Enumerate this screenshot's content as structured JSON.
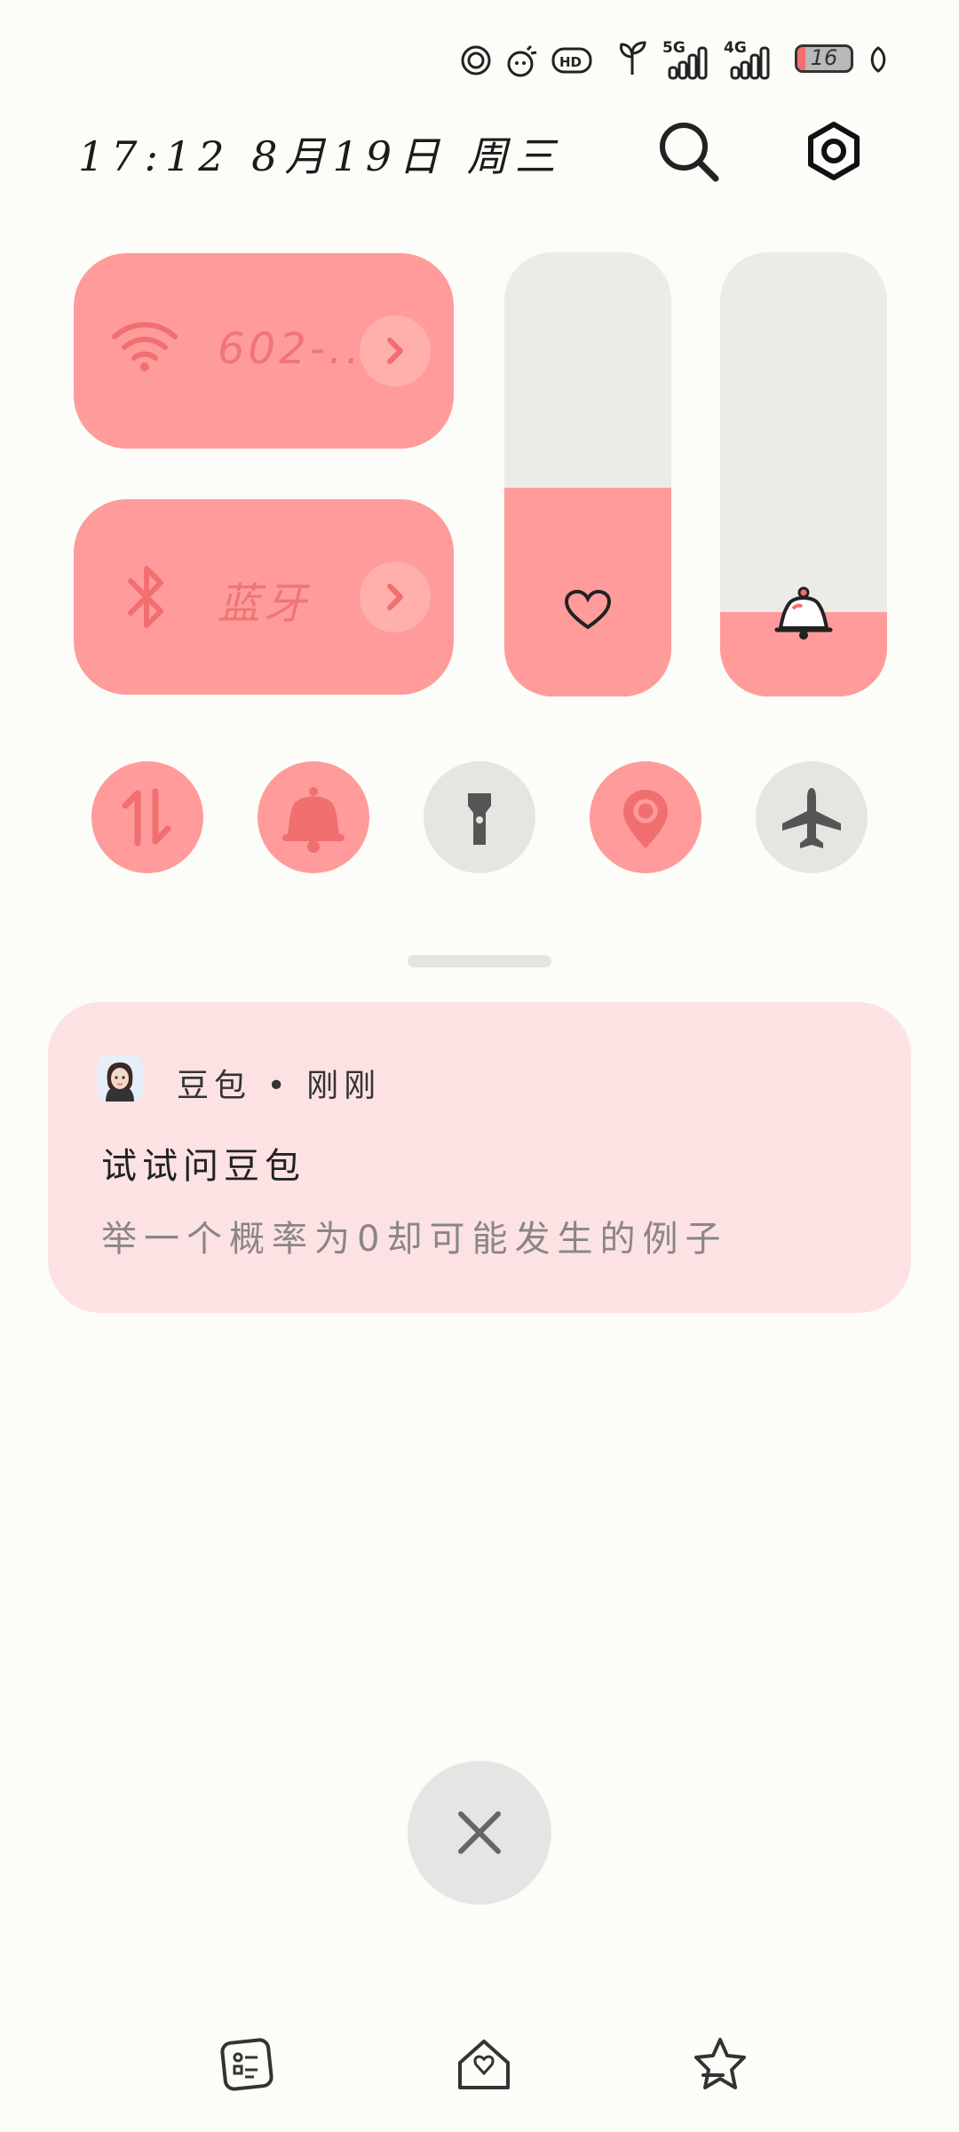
{
  "status_bar": {
    "network_1": "5G",
    "network_2": "4G",
    "battery_level": "16",
    "icons": [
      "circle-c-icon",
      "sun-face-icon",
      "hd-icon",
      "sprout-icon",
      "signal-5g-icon",
      "signal-4g-icon",
      "battery-icon",
      "leaf-icon"
    ]
  },
  "header": {
    "datetime": "17:12 8月19日 周三",
    "search_icon": "search-icon",
    "settings_icon": "settings-icon"
  },
  "tiles": {
    "wifi": {
      "label": "602-..",
      "icon": "wifi-icon"
    },
    "bluetooth": {
      "label": "蓝牙",
      "icon": "bluetooth-icon"
    },
    "brightness": {
      "icon": "heart-icon",
      "level_percent": 47
    },
    "volume": {
      "icon": "bell-icon",
      "level_percent": 19
    }
  },
  "quick_toggles": [
    {
      "name": "mobile-data",
      "icon": "data-transfer-icon",
      "active": true
    },
    {
      "name": "ringer",
      "icon": "bell-icon",
      "active": true
    },
    {
      "name": "flashlight",
      "icon": "flashlight-icon",
      "active": false
    },
    {
      "name": "location",
      "icon": "location-pin-icon",
      "active": true
    },
    {
      "name": "airplane-mode",
      "icon": "airplane-icon",
      "active": false
    }
  ],
  "notification": {
    "app_line": "豆包 • 刚刚",
    "title": "试试问豆包",
    "body": "举一个概率为0却可能发生的例子"
  },
  "close_button": {
    "icon": "close-icon"
  },
  "nav_bar": {
    "icons": [
      "recent-apps-icon",
      "home-icon",
      "back-icon"
    ]
  },
  "colors": {
    "accent": "#ff9b9b",
    "accent_text": "#f07575",
    "background": "#fcfcf8",
    "inactive": "#e6e5e2",
    "notification_bg": "#fde2e4"
  }
}
